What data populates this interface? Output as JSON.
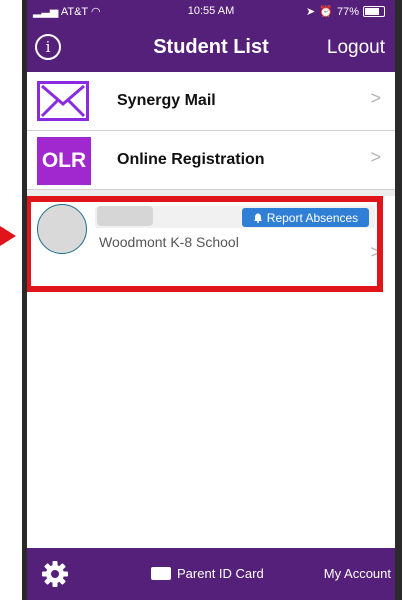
{
  "status_bar": {
    "carrier": "AT&T",
    "time": "10:55 AM",
    "battery": "77%"
  },
  "nav": {
    "title": "Student List",
    "logout_label": "Logout",
    "info_label": "i"
  },
  "menu": [
    {
      "label": "Synergy Mail",
      "icon": "mail-icon"
    },
    {
      "label": "Online Registration",
      "icon_text": "OLR"
    }
  ],
  "student": {
    "school": "Woodmont K-8 School",
    "report_label": "Report Absences"
  },
  "tab_bar": {
    "parent_id_label": "Parent ID Card",
    "my_account_label": "My Account"
  },
  "colors": {
    "brand": "#55207a",
    "accent": "#a128ce",
    "highlight": "#e0141b",
    "button": "#2f7fd6"
  }
}
